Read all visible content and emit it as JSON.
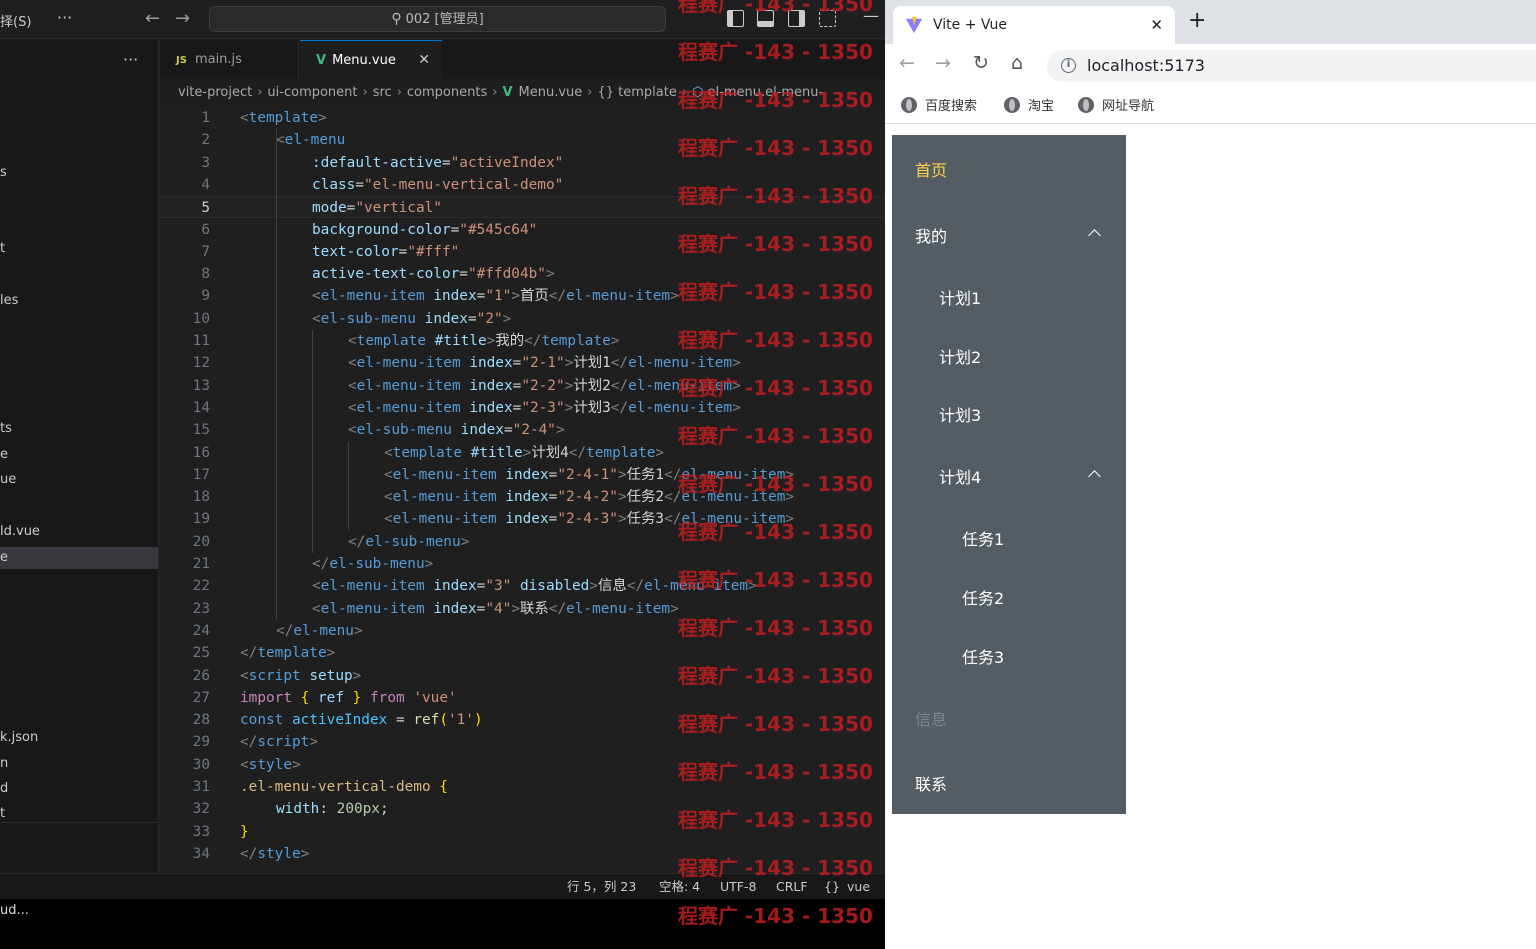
{
  "vscode": {
    "menu_fragment": "择(S)",
    "more": "···",
    "back_arrow": "←",
    "forward_arrow": "→",
    "command_center": "002 [管理员]",
    "minimize": "—",
    "sidebar_more": "···",
    "explorer_fragments": [
      {
        "text": "s",
        "active": false
      },
      {
        "text": "t",
        "active": false
      },
      {
        "text": "les",
        "active": false
      },
      {
        "text": "ts",
        "active": false
      },
      {
        "text": "e",
        "active": false
      },
      {
        "text": "ue",
        "active": false
      },
      {
        "text": "ld.vue",
        "active": false
      },
      {
        "text": "e",
        "active": true
      },
      {
        "text": "k.json",
        "active": false
      },
      {
        "text": "n",
        "active": false
      },
      {
        "text": "d",
        "active": false
      },
      {
        "text": "t",
        "active": false
      }
    ],
    "tabs": [
      {
        "icon": "JS",
        "label": "main.js"
      },
      {
        "icon": "V",
        "label": "Menu.vue",
        "close": "✕"
      }
    ],
    "breadcrumb": {
      "items": [
        "vite-project",
        "ui-component",
        "src",
        "components"
      ],
      "file": "Menu.vue",
      "section": "{} template",
      "element": "el-menu.el-menu-"
    },
    "current_line": 5,
    "status": {
      "position": "行 5，列 23",
      "spaces": "空格: 4",
      "encoding": "UTF-8",
      "eol": "CRLF",
      "language": "vue"
    },
    "bottom_text": "ud...",
    "watermark": "程赛广 -143 - 1350"
  },
  "code_lines": [
    {
      "n": 1,
      "indent": 0,
      "tokens": [
        [
          "tag",
          "<"
        ],
        [
          "tn",
          "template"
        ],
        [
          "tag",
          ">"
        ]
      ]
    },
    {
      "n": 2,
      "indent": 1,
      "tokens": [
        [
          "tag",
          "<"
        ],
        [
          "tn",
          "el-menu"
        ]
      ]
    },
    {
      "n": 3,
      "indent": 2,
      "tokens": [
        [
          "an",
          ":default-active"
        ],
        [
          "txt",
          "="
        ],
        [
          "str",
          "\"activeIndex\""
        ]
      ]
    },
    {
      "n": 4,
      "indent": 2,
      "tokens": [
        [
          "an",
          "class"
        ],
        [
          "txt",
          "="
        ],
        [
          "str",
          "\"el-menu-vertical-demo\""
        ]
      ]
    },
    {
      "n": 5,
      "indent": 2,
      "tokens": [
        [
          "an",
          "mode"
        ],
        [
          "txt",
          "="
        ],
        [
          "str",
          "\"vertical\""
        ]
      ]
    },
    {
      "n": 6,
      "indent": 2,
      "tokens": [
        [
          "an",
          "background-color"
        ],
        [
          "txt",
          "="
        ],
        [
          "str",
          "\"#545c64\""
        ]
      ]
    },
    {
      "n": 7,
      "indent": 2,
      "tokens": [
        [
          "an",
          "text-color"
        ],
        [
          "txt",
          "="
        ],
        [
          "str",
          "\"#fff\""
        ]
      ]
    },
    {
      "n": 8,
      "indent": 2,
      "tokens": [
        [
          "an",
          "active-text-color"
        ],
        [
          "txt",
          "="
        ],
        [
          "str",
          "\"#ffd04b\""
        ],
        [
          "tag",
          ">"
        ]
      ]
    },
    {
      "n": 9,
      "indent": 2,
      "tokens": [
        [
          "tag",
          "<"
        ],
        [
          "tn",
          "el-menu-item"
        ],
        [
          "txt",
          " "
        ],
        [
          "an",
          "index"
        ],
        [
          "txt",
          "="
        ],
        [
          "str",
          "\"1\""
        ],
        [
          "tag",
          ">"
        ],
        [
          "txt",
          "首页"
        ],
        [
          "tag",
          "</"
        ],
        [
          "tn",
          "el-menu-item"
        ],
        [
          "tag",
          ">"
        ]
      ]
    },
    {
      "n": 10,
      "indent": 2,
      "tokens": [
        [
          "tag",
          "<"
        ],
        [
          "tn",
          "el-sub-menu"
        ],
        [
          "txt",
          " "
        ],
        [
          "an",
          "index"
        ],
        [
          "txt",
          "="
        ],
        [
          "str",
          "\"2\""
        ],
        [
          "tag",
          ">"
        ]
      ]
    },
    {
      "n": 11,
      "indent": 3,
      "tokens": [
        [
          "tag",
          "<"
        ],
        [
          "tn",
          "template"
        ],
        [
          "txt",
          " "
        ],
        [
          "an",
          "#title"
        ],
        [
          "tag",
          ">"
        ],
        [
          "txt",
          "我的"
        ],
        [
          "tag",
          "</"
        ],
        [
          "tn",
          "template"
        ],
        [
          "tag",
          ">"
        ]
      ]
    },
    {
      "n": 12,
      "indent": 3,
      "tokens": [
        [
          "tag",
          "<"
        ],
        [
          "tn",
          "el-menu-item"
        ],
        [
          "txt",
          " "
        ],
        [
          "an",
          "index"
        ],
        [
          "txt",
          "="
        ],
        [
          "str",
          "\"2-1\""
        ],
        [
          "tag",
          ">"
        ],
        [
          "txt",
          "计划1"
        ],
        [
          "tag",
          "</"
        ],
        [
          "tn",
          "el-menu-item"
        ],
        [
          "tag",
          ">"
        ]
      ]
    },
    {
      "n": 13,
      "indent": 3,
      "tokens": [
        [
          "tag",
          "<"
        ],
        [
          "tn",
          "el-menu-item"
        ],
        [
          "txt",
          " "
        ],
        [
          "an",
          "index"
        ],
        [
          "txt",
          "="
        ],
        [
          "str",
          "\"2-2\""
        ],
        [
          "tag",
          ">"
        ],
        [
          "txt",
          "计划2"
        ],
        [
          "tag",
          "</"
        ],
        [
          "tn",
          "el-menu-item"
        ],
        [
          "tag",
          ">"
        ]
      ]
    },
    {
      "n": 14,
      "indent": 3,
      "tokens": [
        [
          "tag",
          "<"
        ],
        [
          "tn",
          "el-menu-item"
        ],
        [
          "txt",
          " "
        ],
        [
          "an",
          "index"
        ],
        [
          "txt",
          "="
        ],
        [
          "str",
          "\"2-3\""
        ],
        [
          "tag",
          ">"
        ],
        [
          "txt",
          "计划3"
        ],
        [
          "tag",
          "</"
        ],
        [
          "tn",
          "el-menu-item"
        ],
        [
          "tag",
          ">"
        ]
      ]
    },
    {
      "n": 15,
      "indent": 3,
      "tokens": [
        [
          "tag",
          "<"
        ],
        [
          "tn",
          "el-sub-menu"
        ],
        [
          "txt",
          " "
        ],
        [
          "an",
          "index"
        ],
        [
          "txt",
          "="
        ],
        [
          "str",
          "\"2-4\""
        ],
        [
          "tag",
          ">"
        ]
      ]
    },
    {
      "n": 16,
      "indent": 4,
      "tokens": [
        [
          "tag",
          "<"
        ],
        [
          "tn",
          "template"
        ],
        [
          "txt",
          " "
        ],
        [
          "an",
          "#title"
        ],
        [
          "tag",
          ">"
        ],
        [
          "txt",
          "计划4"
        ],
        [
          "tag",
          "</"
        ],
        [
          "tn",
          "template"
        ],
        [
          "tag",
          ">"
        ]
      ]
    },
    {
      "n": 17,
      "indent": 4,
      "tokens": [
        [
          "tag",
          "<"
        ],
        [
          "tn",
          "el-menu-item"
        ],
        [
          "txt",
          " "
        ],
        [
          "an",
          "index"
        ],
        [
          "txt",
          "="
        ],
        [
          "str",
          "\"2-4-1\""
        ],
        [
          "tag",
          ">"
        ],
        [
          "txt",
          "任务1"
        ],
        [
          "tag",
          "</"
        ],
        [
          "tn",
          "el-menu-item"
        ],
        [
          "tag",
          ">"
        ]
      ]
    },
    {
      "n": 18,
      "indent": 4,
      "tokens": [
        [
          "tag",
          "<"
        ],
        [
          "tn",
          "el-menu-item"
        ],
        [
          "txt",
          " "
        ],
        [
          "an",
          "index"
        ],
        [
          "txt",
          "="
        ],
        [
          "str",
          "\"2-4-2\""
        ],
        [
          "tag",
          ">"
        ],
        [
          "txt",
          "任务2"
        ],
        [
          "tag",
          "</"
        ],
        [
          "tn",
          "el-menu-item"
        ],
        [
          "tag",
          ">"
        ]
      ]
    },
    {
      "n": 19,
      "indent": 4,
      "tokens": [
        [
          "tag",
          "<"
        ],
        [
          "tn",
          "el-menu-item"
        ],
        [
          "txt",
          " "
        ],
        [
          "an",
          "index"
        ],
        [
          "txt",
          "="
        ],
        [
          "str",
          "\"2-4-3\""
        ],
        [
          "tag",
          ">"
        ],
        [
          "txt",
          "任务3"
        ],
        [
          "tag",
          "</"
        ],
        [
          "tn",
          "el-menu-item"
        ],
        [
          "tag",
          ">"
        ]
      ]
    },
    {
      "n": 20,
      "indent": 3,
      "tokens": [
        [
          "tag",
          "</"
        ],
        [
          "tn",
          "el-sub-menu"
        ],
        [
          "tag",
          ">"
        ]
      ]
    },
    {
      "n": 21,
      "indent": 2,
      "tokens": [
        [
          "tag",
          "</"
        ],
        [
          "tn",
          "el-sub-menu"
        ],
        [
          "tag",
          ">"
        ]
      ]
    },
    {
      "n": 22,
      "indent": 2,
      "tokens": [
        [
          "tag",
          "<"
        ],
        [
          "tn",
          "el-menu-item"
        ],
        [
          "txt",
          " "
        ],
        [
          "an",
          "index"
        ],
        [
          "txt",
          "="
        ],
        [
          "str",
          "\"3\""
        ],
        [
          "txt",
          " "
        ],
        [
          "an",
          "disabled"
        ],
        [
          "tag",
          ">"
        ],
        [
          "txt",
          "信息"
        ],
        [
          "tag",
          "</"
        ],
        [
          "tn",
          "el-menu-item"
        ],
        [
          "tag",
          ">"
        ]
      ]
    },
    {
      "n": 23,
      "indent": 2,
      "tokens": [
        [
          "tag",
          "<"
        ],
        [
          "tn",
          "el-menu-item"
        ],
        [
          "txt",
          " "
        ],
        [
          "an",
          "index"
        ],
        [
          "txt",
          "="
        ],
        [
          "str",
          "\"4\""
        ],
        [
          "tag",
          ">"
        ],
        [
          "txt",
          "联系"
        ],
        [
          "tag",
          "</"
        ],
        [
          "tn",
          "el-menu-item"
        ],
        [
          "tag",
          ">"
        ]
      ]
    },
    {
      "n": 24,
      "indent": 1,
      "tokens": [
        [
          "tag",
          "</"
        ],
        [
          "tn",
          "el-menu"
        ],
        [
          "tag",
          ">"
        ]
      ]
    },
    {
      "n": 25,
      "indent": 0,
      "tokens": [
        [
          "tag",
          "</"
        ],
        [
          "tn",
          "template"
        ],
        [
          "tag",
          ">"
        ]
      ]
    },
    {
      "n": 26,
      "indent": 0,
      "tokens": [
        [
          "tag",
          "<"
        ],
        [
          "tn",
          "script"
        ],
        [
          "txt",
          " "
        ],
        [
          "an",
          "setup"
        ],
        [
          "tag",
          ">"
        ]
      ]
    },
    {
      "n": 27,
      "indent": 0,
      "tokens": [
        [
          "kw",
          "import"
        ],
        [
          "txt",
          " "
        ],
        [
          "br",
          "{"
        ],
        [
          "txt",
          " "
        ],
        [
          "an",
          "ref"
        ],
        [
          "txt",
          " "
        ],
        [
          "br",
          "}"
        ],
        [
          "txt",
          " "
        ],
        [
          "kw",
          "from"
        ],
        [
          "txt",
          " "
        ],
        [
          "str",
          "'vue'"
        ]
      ]
    },
    {
      "n": 28,
      "indent": 0,
      "tokens": [
        [
          "kw2",
          "const"
        ],
        [
          "txt",
          " "
        ],
        [
          "var",
          "activeIndex"
        ],
        [
          "txt",
          " = "
        ],
        [
          "fn",
          "ref"
        ],
        [
          "br",
          "("
        ],
        [
          "str",
          "'1'"
        ],
        [
          "br",
          ")"
        ]
      ]
    },
    {
      "n": 29,
      "indent": 0,
      "tokens": [
        [
          "tag",
          "</"
        ],
        [
          "tn",
          "script"
        ],
        [
          "tag",
          ">"
        ]
      ]
    },
    {
      "n": 30,
      "indent": 0,
      "tokens": [
        [
          "tag",
          "<"
        ],
        [
          "tn",
          "style"
        ],
        [
          "tag",
          ">"
        ]
      ]
    },
    {
      "n": 31,
      "indent": 0,
      "tokens": [
        [
          "sel",
          ".el-menu-vertical-demo"
        ],
        [
          "txt",
          " "
        ],
        [
          "br",
          "{"
        ]
      ]
    },
    {
      "n": 32,
      "indent": 1,
      "tokens": [
        [
          "an",
          "width"
        ],
        [
          "txt",
          ": "
        ],
        [
          "num",
          "200px"
        ],
        [
          "txt",
          ";"
        ]
      ]
    },
    {
      "n": 33,
      "indent": 0,
      "tokens": [
        [
          "br",
          "}"
        ]
      ]
    },
    {
      "n": 34,
      "indent": 0,
      "tokens": [
        [
          "tag",
          "</"
        ],
        [
          "tn",
          "style"
        ],
        [
          "tag",
          ">"
        ]
      ]
    }
  ],
  "browser": {
    "tab_title": "Vite + Vue",
    "tab_close": "✕",
    "new_tab": "+",
    "back": "←",
    "forward": "→",
    "reload": "↻",
    "home": "⌂",
    "url": "localhost:5173",
    "bookmarks": [
      "百度搜索",
      "淘宝",
      "网址导航"
    ]
  },
  "el_menu": {
    "background": "#545c64",
    "text_color": "#fff",
    "active_text_color": "#ffd04b",
    "items": [
      {
        "label": "首页",
        "level": 0,
        "state": "active"
      },
      {
        "label": "我的",
        "level": 0,
        "state": "open"
      },
      {
        "label": "计划1",
        "level": 1,
        "state": "normal"
      },
      {
        "label": "计划2",
        "level": 1,
        "state": "normal"
      },
      {
        "label": "计划3",
        "level": 1,
        "state": "normal"
      },
      {
        "label": "计划4",
        "level": 1,
        "state": "open"
      },
      {
        "label": "任务1",
        "level": 2,
        "state": "normal"
      },
      {
        "label": "任务2",
        "level": 2,
        "state": "normal"
      },
      {
        "label": "任务3",
        "level": 2,
        "state": "normal"
      },
      {
        "label": "信息",
        "level": 0,
        "state": "disabled"
      },
      {
        "label": "联系",
        "level": 0,
        "state": "normal"
      }
    ]
  }
}
